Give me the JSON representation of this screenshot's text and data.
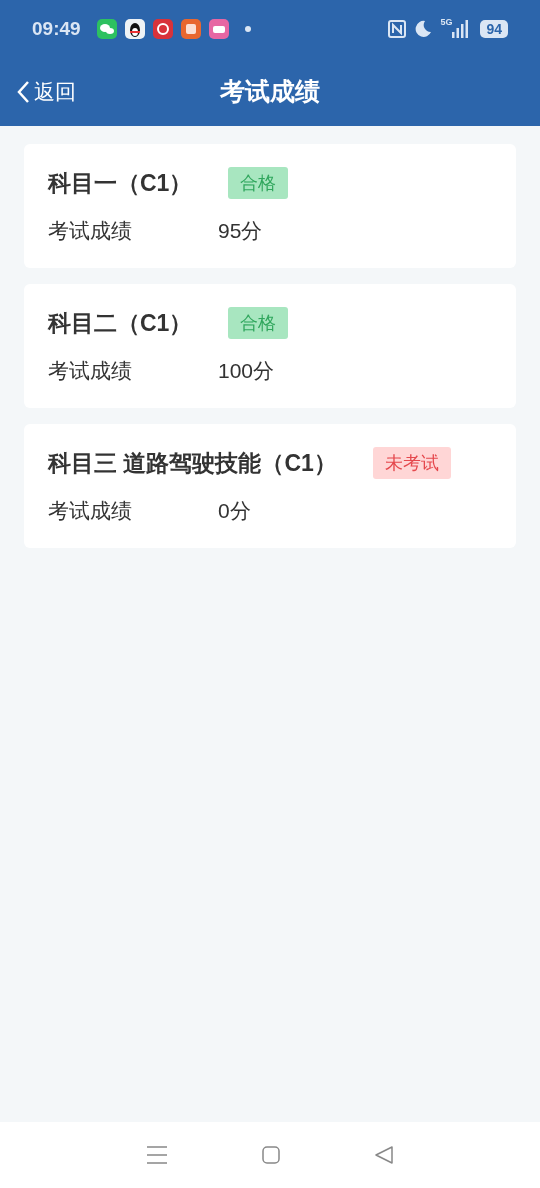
{
  "status_bar": {
    "time": "09:49",
    "network": "5G",
    "battery": "94"
  },
  "header": {
    "back": "返回",
    "title": "考试成绩"
  },
  "results": [
    {
      "subject": "科目一（C1）",
      "status": {
        "kind": "passed",
        "label": "合格"
      },
      "score_label": "考试成绩",
      "score": "95分"
    },
    {
      "subject": "科目二（C1）",
      "status": {
        "kind": "passed",
        "label": "合格"
      },
      "score_label": "考试成绩",
      "score": "100分"
    },
    {
      "subject": "科目三 道路驾驶技能（C1）",
      "status": {
        "kind": "not_taken",
        "label": "未考试"
      },
      "score_label": "考试成绩",
      "score": "0分"
    }
  ]
}
